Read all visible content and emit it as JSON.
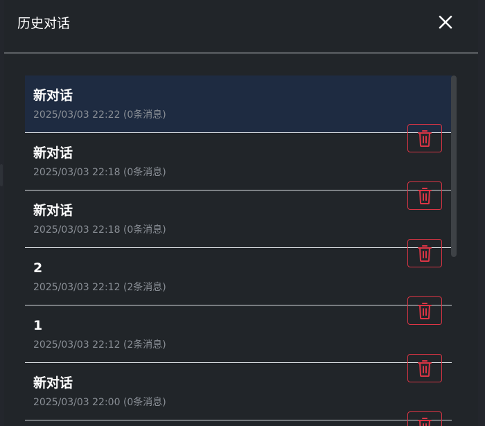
{
  "dialog": {
    "title": "历史对话",
    "close_icon": "close-icon"
  },
  "conversations": [
    {
      "title": "新对话",
      "meta": "2025/03/03 22:22 (0条消息)",
      "active": true
    },
    {
      "title": "新对话",
      "meta": "2025/03/03 22:18 (0条消息)"
    },
    {
      "title": "新对话",
      "meta": "2025/03/03 22:18 (0条消息)"
    },
    {
      "title": "2",
      "meta": "2025/03/03 22:12 (2条消息)"
    },
    {
      "title": "1",
      "meta": "2025/03/03 22:12 (2条消息)"
    },
    {
      "title": "新对话",
      "meta": "2025/03/03 22:00 (0条消息)"
    }
  ],
  "delete_icon": "trash-icon",
  "colors": {
    "background": "#212529",
    "active_item": "#1e2b41",
    "danger": "#dc3545",
    "muted_text": "#8a8f96"
  }
}
